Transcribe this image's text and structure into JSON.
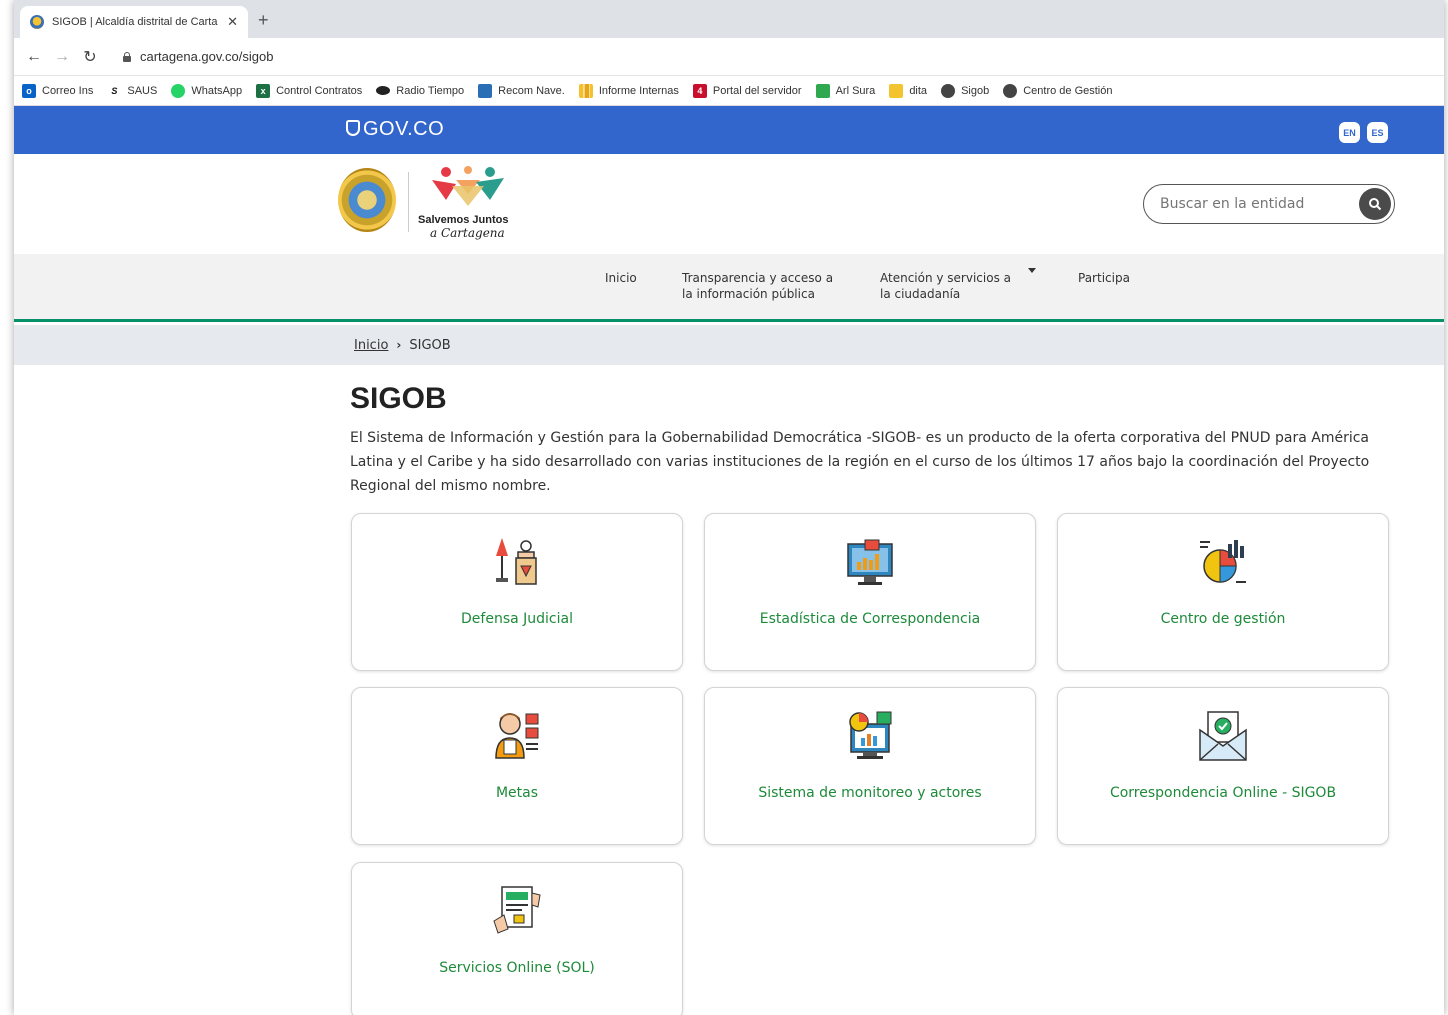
{
  "browser": {
    "tab_title": "SIGOB | Alcaldía distrital de Carta",
    "url": "cartagena.gov.co/sigob",
    "bookmarks": [
      {
        "label": "Correo Ins",
        "icon": "outlook-icon"
      },
      {
        "label": "SAUS",
        "icon": "s-icon"
      },
      {
        "label": "WhatsApp",
        "icon": "whatsapp-icon"
      },
      {
        "label": "Control Contratos",
        "icon": "excel-icon"
      },
      {
        "label": "Radio Tiempo",
        "icon": "radio-icon"
      },
      {
        "label": "Recom Nave.",
        "icon": "document-icon"
      },
      {
        "label": "Informe Internas",
        "icon": "bar-icon"
      },
      {
        "label": "Portal del servidor",
        "icon": "portal-icon"
      },
      {
        "label": "Arl Sura",
        "icon": "sura-icon"
      },
      {
        "label": "dita",
        "icon": "folder-icon"
      },
      {
        "label": "Sigob",
        "icon": "globe-icon"
      },
      {
        "label": "Centro de Gestión",
        "icon": "globe-icon"
      }
    ]
  },
  "gov": {
    "logo_text": "GOV.CO",
    "lang_en": "EN",
    "lang_es": "ES"
  },
  "header": {
    "brand_line1": "Salvemos Juntos",
    "brand_line2": "a Cartagena",
    "search_placeholder": "Buscar en la entidad"
  },
  "nav": {
    "inicio": "Inicio",
    "transparencia_1": "Transparencia y acceso a",
    "transparencia_2": "la información pública",
    "atencion_1": "Atención y servicios a",
    "atencion_2": "la ciudadanía",
    "participa": "Participa"
  },
  "breadcrumb": {
    "home": "Inicio",
    "current": "SIGOB"
  },
  "page": {
    "title": "SIGOB",
    "intro": "El Sistema de Información y Gestión para la Gobernabilidad Democrática -SIGOB- es un producto de la oferta corporativa del PNUD para América Latina y el Caribe y ha sido desarrollado con varias instituciones de la región en el curso de los últimos 17 años bajo la coordinación del Proyecto Regional del mismo nombre."
  },
  "cards": [
    {
      "label": "Defensa Judicial",
      "icon": "justice-podium-icon"
    },
    {
      "label": "Estadística de Correspondencia",
      "icon": "statistics-monitor-icon"
    },
    {
      "label": "Centro de gestión",
      "icon": "pie-chart-icon"
    },
    {
      "label": "Metas",
      "icon": "checklist-person-icon"
    },
    {
      "label": "Sistema de monitoreo y actores",
      "icon": "monitoring-screen-icon"
    },
    {
      "label": "Correspondencia Online - SIGOB",
      "icon": "envelope-check-icon"
    },
    {
      "label": "Servicios Online (SOL)",
      "icon": "online-form-icon"
    }
  ],
  "colors": {
    "gov_blue": "#3366cc",
    "nav_green": "#069169",
    "card_label_green": "#1e8a3a"
  }
}
